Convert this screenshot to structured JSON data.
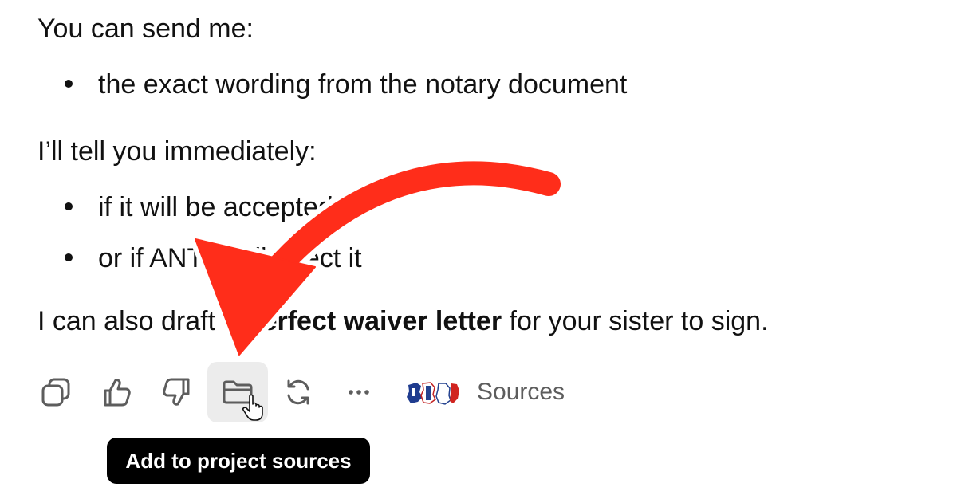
{
  "message": {
    "intro": "You can send me:",
    "send_items": [
      "the exact wording from the notary document"
    ],
    "tell_intro": "I’ll tell you immediately:",
    "tell_items": [
      "if it will be accepted",
      "or if ANTS will reject it"
    ],
    "closing_before": "I can also draft a ",
    "closing_bold": "perfect waiver letter",
    "closing_after": " for your sister to sign."
  },
  "toolbar": {
    "buttons": [
      {
        "icon": "copy-icon"
      },
      {
        "icon": "thumbs-up-icon"
      },
      {
        "icon": "thumbs-down-icon"
      },
      {
        "icon": "folder-add-icon",
        "state": "hovered"
      },
      {
        "icon": "regenerate-icon"
      },
      {
        "icon": "more-icon"
      }
    ],
    "sources_label": "Sources"
  },
  "tooltip": {
    "text": "Add to project sources"
  },
  "colors": {
    "text": "#111111",
    "icon": "#5d5d5d",
    "hover_bg": "#ececec",
    "tooltip_bg": "#000000",
    "annotation_arrow": "#ff2d1a"
  }
}
